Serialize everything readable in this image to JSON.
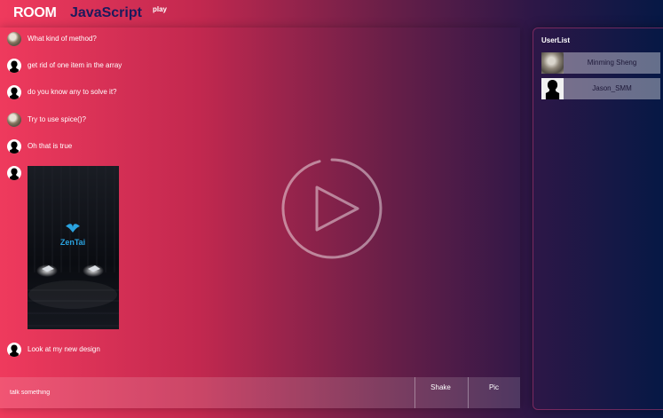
{
  "header": {
    "room_label": "ROOM",
    "room_name": "JavaScript",
    "play_label": "play"
  },
  "messages": [
    {
      "avatar": "photo-avatar",
      "text": "What kind of method?"
    },
    {
      "avatar": "silhouette-avatar",
      "text": "get rid of one item in the array"
    },
    {
      "avatar": "silhouette-avatar",
      "text": "do you know any to solve it?"
    },
    {
      "avatar": "photo-avatar",
      "text": "Try to use spice()?"
    },
    {
      "avatar": "silhouette-avatar",
      "text": "Oh that is true"
    },
    {
      "avatar": "silhouette-avatar",
      "image": {
        "logo_text": "ZenTai"
      }
    },
    {
      "avatar": "silhouette-avatar",
      "text": "Look at my new design"
    }
  ],
  "input": {
    "placeholder": "talk something"
  },
  "buttons": {
    "shake": "Shake",
    "pic": "Pic"
  },
  "userlist": {
    "title": "UserList",
    "users": [
      {
        "name": "Minming Sheng",
        "avatar": "photo-avatar"
      },
      {
        "name": "Jason_SMM",
        "avatar": "silhouette-avatar"
      }
    ]
  },
  "colors": {
    "room_name": "#1b1a5c",
    "gradient_left": "#ef3a5d",
    "gradient_right": "#061845",
    "logo": "#2aa3e0"
  },
  "overlay": {
    "icon": "play-circle-icon"
  }
}
